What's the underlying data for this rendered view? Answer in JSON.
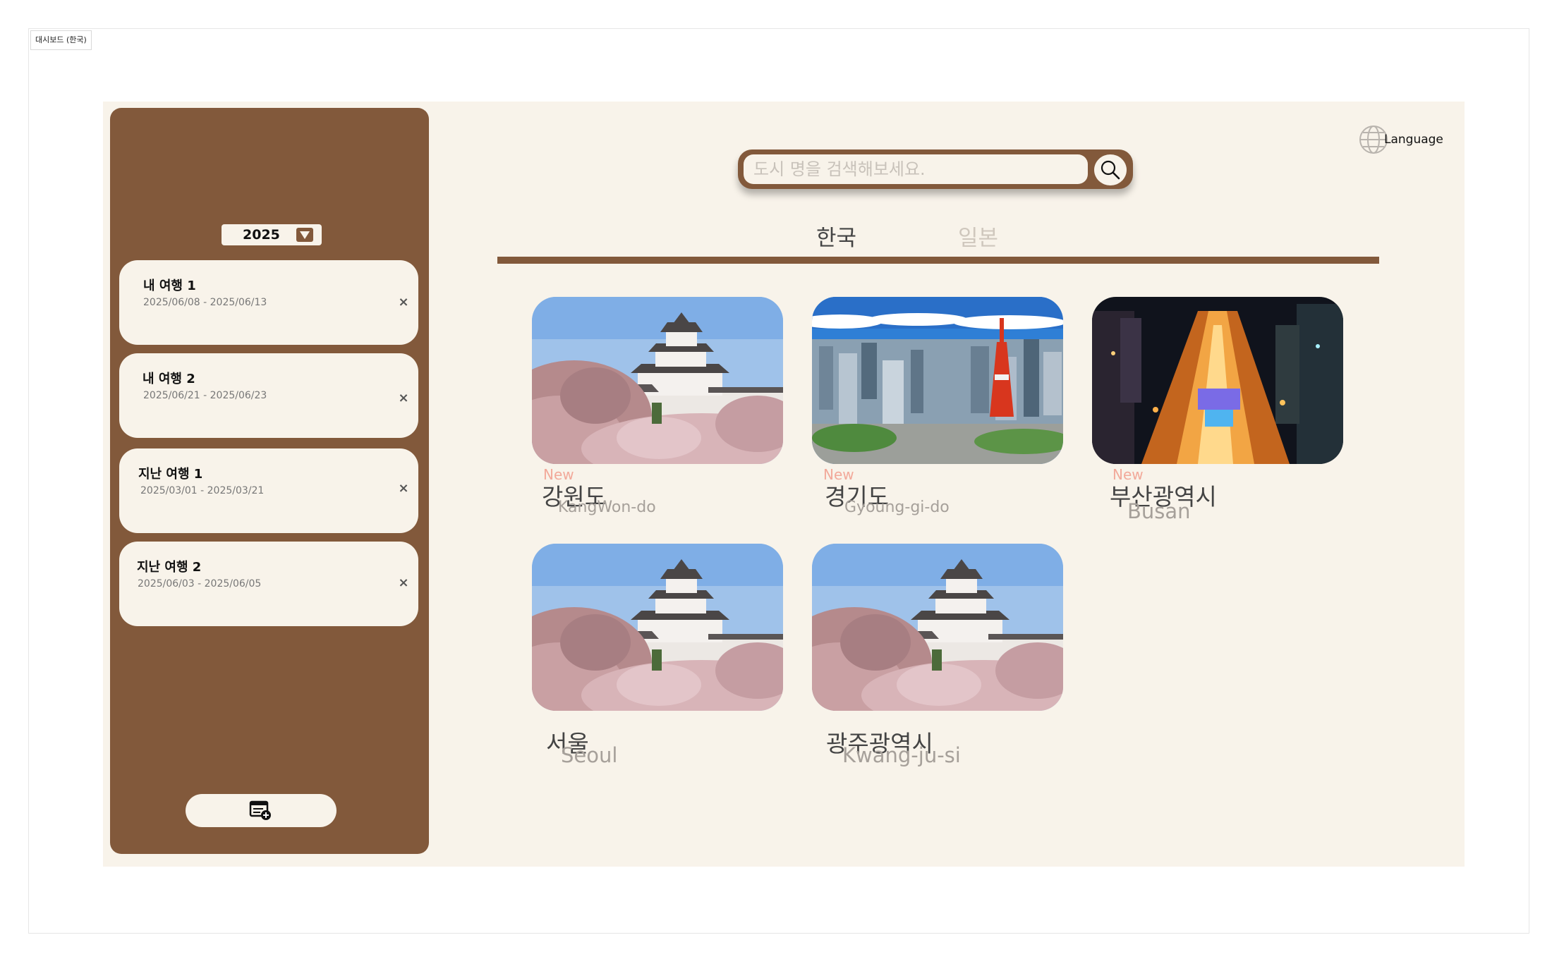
{
  "frame": {
    "label": "대시보드 (한국)"
  },
  "sidebar": {
    "year": "2025",
    "trips": [
      {
        "title": "내 여행 1",
        "dates": "2025/06/08 - 2025/06/13",
        "delete": "×"
      },
      {
        "title": "내 여행 2",
        "dates": "2025/06/21 - 2025/06/23",
        "delete": "×"
      },
      {
        "title": "지난 여행 1",
        "dates": "2025/03/01 - 2025/03/21",
        "delete": "×"
      },
      {
        "title": "지난 여행 2",
        "dates": "2025/06/03 - 2025/06/05",
        "delete": "×"
      }
    ],
    "add_icon": "add-calendar-icon"
  },
  "search": {
    "placeholder": "도시 명을 검색해보세요.",
    "icon": "search-icon"
  },
  "language": {
    "label": "Language",
    "icon": "globe-icon"
  },
  "tabs": [
    {
      "label": "한국",
      "active": true
    },
    {
      "label": "일본",
      "active": false
    }
  ],
  "regions": [
    {
      "name_ko": "강원도",
      "name_en": "KangWon-do",
      "badge": "New",
      "image": "castle-cherry-blossom"
    },
    {
      "name_ko": "경기도",
      "name_en": "Gyoung-gi-do",
      "badge": "New",
      "image": "city-tower-skyline"
    },
    {
      "name_ko": "부산광역시",
      "name_en": "Busan",
      "badge": "New",
      "image": "night-city-street"
    },
    {
      "name_ko": "서울",
      "name_en": "Seoul",
      "image": "castle-cherry-blossom"
    },
    {
      "name_ko": "광주광역시",
      "name_en": "Kwang-ju-si",
      "image": "castle-cherry-blossom"
    }
  ],
  "colors": {
    "brown": "#82593b",
    "cream": "#f8f3ea",
    "badge": "#f2a99a"
  }
}
